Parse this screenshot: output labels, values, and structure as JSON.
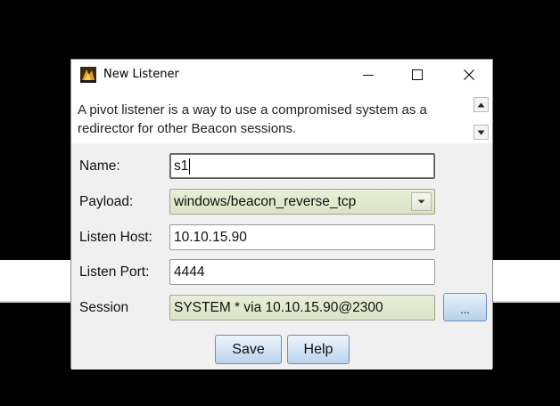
{
  "window": {
    "title": "New Listener",
    "minimize_glyph": "—",
    "maximize_glyph": "☐",
    "close_glyph": "✕"
  },
  "description": "A pivot listener is a way to use a compromised system as a redirector for other Beacon sessions.",
  "form": {
    "name": {
      "label": "Name:",
      "value": "s1"
    },
    "payload": {
      "label": "Payload:",
      "value": "windows/beacon_reverse_tcp"
    },
    "listen_host": {
      "label": "Listen Host:",
      "value": "10.10.15.90"
    },
    "listen_port": {
      "label": "Listen Port:",
      "value": "4444"
    },
    "session": {
      "label": "Session",
      "value": "SYSTEM * via  10.10.15.90@2300",
      "browse_label": "..."
    }
  },
  "buttons": {
    "save": "Save",
    "help": "Help"
  },
  "colors": {
    "field_green": "#dbe3c6",
    "button_blue": "#bcd3ec",
    "form_bg": "#f0f0f0"
  },
  "icons": {
    "app": "cobalt-strike-icon",
    "scroll_up": "scroll-up-arrow-icon",
    "scroll_down": "scroll-down-arrow-icon",
    "dropdown": "chevron-down-icon"
  }
}
